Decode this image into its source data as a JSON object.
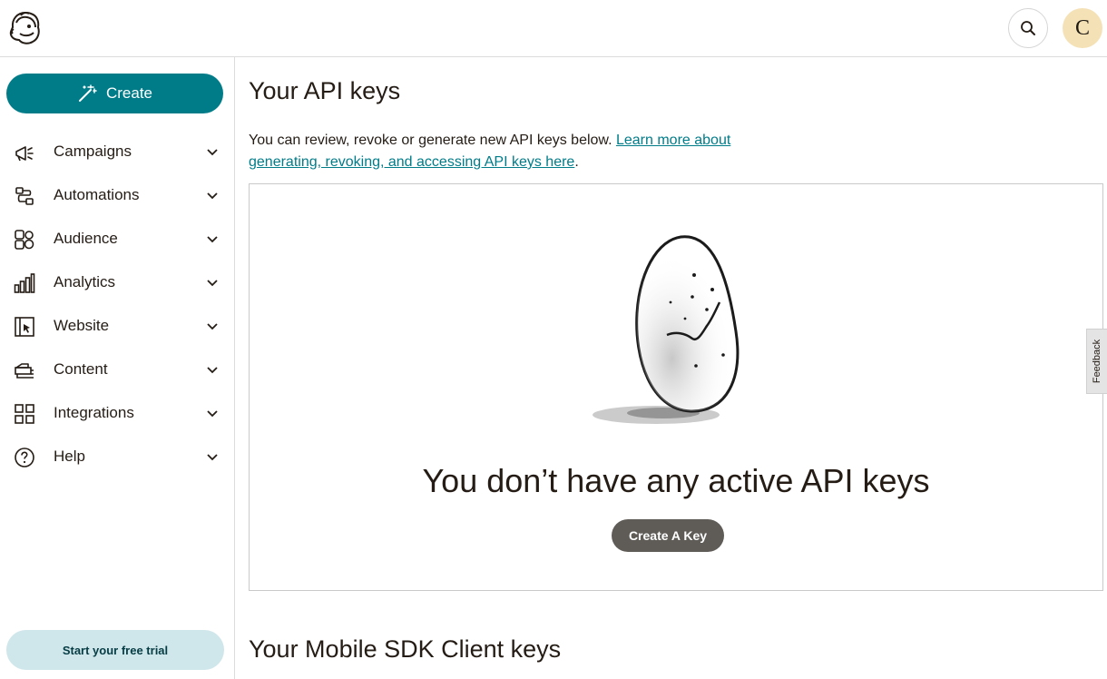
{
  "topbar": {
    "avatar_letter": "C",
    "icons": {
      "logo": "mailchimp-freddie-logo",
      "search": "search-icon"
    }
  },
  "sidebar": {
    "create_label": "Create",
    "items": [
      {
        "label": "Campaigns",
        "icon": "megaphone-icon"
      },
      {
        "label": "Automations",
        "icon": "automations-icon"
      },
      {
        "label": "Audience",
        "icon": "audience-icon"
      },
      {
        "label": "Analytics",
        "icon": "bar-chart-icon"
      },
      {
        "label": "Website",
        "icon": "website-icon"
      },
      {
        "label": "Content",
        "icon": "content-icon"
      },
      {
        "label": "Integrations",
        "icon": "grid-icon"
      },
      {
        "label": "Help",
        "icon": "help-icon"
      }
    ],
    "trial_label": "Start your free trial"
  },
  "main": {
    "title": "Your API keys",
    "description": "You can review, revoke or generate new API keys below. ",
    "learn_more_link": "Learn more about generating, revoking, and accessing API keys here",
    "description_end": ".",
    "empty_title": "You don’t have any active API keys",
    "create_key_label": "Create A Key",
    "sdk_title": "Your Mobile SDK Client keys"
  },
  "feedback_label": "Feedback",
  "colors": {
    "accent": "#007c89",
    "trial_bg": "#cfe6ea",
    "secondary_button": "#5f5c58"
  }
}
